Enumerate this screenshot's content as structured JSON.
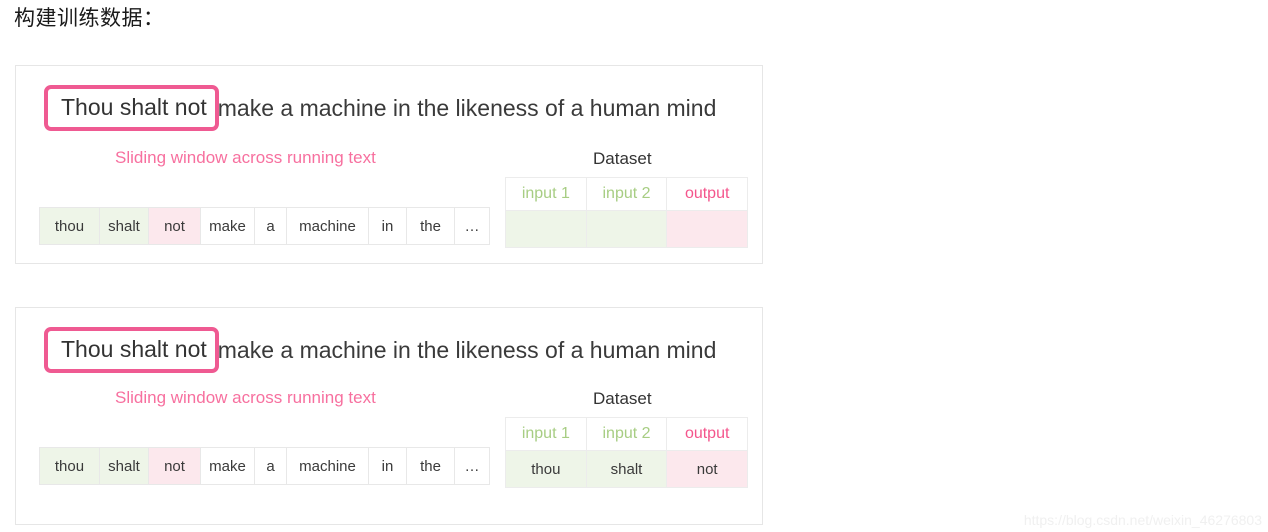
{
  "page": {
    "title": "构建训练数据：",
    "watermark": "https://blog.csdn.net/weixin_46276803",
    "colors": {
      "window_border": "#ef5a92",
      "sliding_caption": "#f7709f",
      "input_header": "#a7cd83",
      "output_header": "#f4558c",
      "cell_green": "#eef5e8",
      "cell_pink": "#fce8ed",
      "panel_border": "#e6e6e6",
      "text": "#3a3a3a"
    }
  },
  "panels": [
    {
      "sentence": {
        "window_text": "Thou shalt not",
        "rest_text": "make a machine in the likeness of a human mind"
      },
      "sliding_caption": "Sliding window across running text",
      "dataset_caption": "Dataset",
      "tokens": [
        {
          "text": "thou",
          "highlight": "green"
        },
        {
          "text": "shalt",
          "highlight": "green"
        },
        {
          "text": "not",
          "highlight": "pink"
        },
        {
          "text": "make",
          "highlight": "none"
        },
        {
          "text": "a",
          "highlight": "none"
        },
        {
          "text": "machine",
          "highlight": "none"
        },
        {
          "text": "in",
          "highlight": "none"
        },
        {
          "text": "the",
          "highlight": "none"
        },
        {
          "text": "…",
          "highlight": "none"
        }
      ],
      "dataset": {
        "headers": [
          {
            "label": "input 1",
            "color": "green"
          },
          {
            "label": "input 2",
            "color": "green"
          },
          {
            "label": "output",
            "color": "pink"
          }
        ],
        "row": [
          {
            "value": "",
            "fill": "green"
          },
          {
            "value": "",
            "fill": "green"
          },
          {
            "value": "",
            "fill": "pink"
          }
        ]
      }
    },
    {
      "sentence": {
        "window_text": "Thou shalt not",
        "rest_text": "make a machine in the likeness of a human mind"
      },
      "sliding_caption": "Sliding window across running text",
      "dataset_caption": "Dataset",
      "tokens": [
        {
          "text": "thou",
          "highlight": "green"
        },
        {
          "text": "shalt",
          "highlight": "green"
        },
        {
          "text": "not",
          "highlight": "pink"
        },
        {
          "text": "make",
          "highlight": "none"
        },
        {
          "text": "a",
          "highlight": "none"
        },
        {
          "text": "machine",
          "highlight": "none"
        },
        {
          "text": "in",
          "highlight": "none"
        },
        {
          "text": "the",
          "highlight": "none"
        },
        {
          "text": "…",
          "highlight": "none"
        }
      ],
      "dataset": {
        "headers": [
          {
            "label": "input 1",
            "color": "green"
          },
          {
            "label": "input 2",
            "color": "green"
          },
          {
            "label": "output",
            "color": "pink"
          }
        ],
        "row": [
          {
            "value": "thou",
            "fill": "green"
          },
          {
            "value": "shalt",
            "fill": "green"
          },
          {
            "value": "not",
            "fill": "pink"
          }
        ]
      }
    }
  ]
}
